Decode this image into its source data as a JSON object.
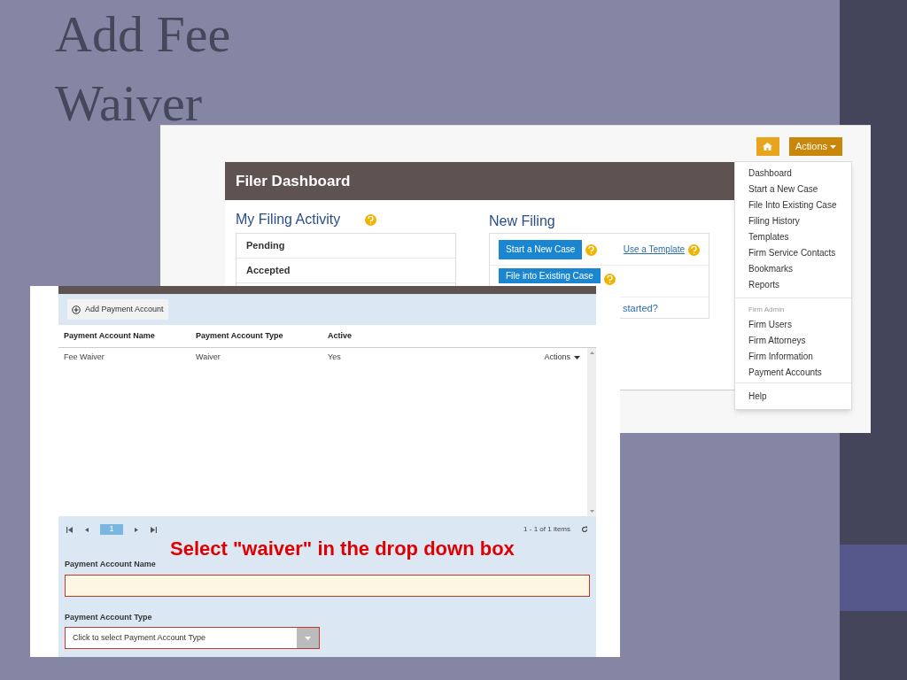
{
  "slide": {
    "title": "Add Fee Waiver",
    "callout": "Select \"waiver\" in the drop down box"
  },
  "dashboard": {
    "actions_button": "Actions",
    "header": "Filer Dashboard",
    "activity": {
      "title": "My Filing Activity",
      "items": [
        "Pending",
        "Accepted"
      ]
    },
    "new_filing": {
      "title": "New Filing",
      "start_button": "Start a New Case",
      "template_link": "Use a Template",
      "file_button": "File into Existing Case",
      "help_link": "started?"
    },
    "menu": {
      "groups": [
        {
          "items": [
            "Dashboard",
            "Start a New Case",
            "File Into Existing Case",
            "Filing History",
            "Templates",
            "Firm Service Contacts",
            "Bookmarks",
            "Reports"
          ]
        },
        {
          "heading": "Firm Admin",
          "items": [
            "Firm Users",
            "Firm Attorneys",
            "Firm Information",
            "Payment Accounts"
          ]
        },
        {
          "items": [
            "Help"
          ]
        }
      ]
    }
  },
  "payment": {
    "add_button": "Add Payment Account",
    "columns": [
      "Payment Account Name",
      "Payment Account Type",
      "Active"
    ],
    "rows": [
      {
        "cells": [
          "Fee Waiver",
          "Waiver",
          "Yes"
        ],
        "action": "Actions"
      }
    ],
    "pager": {
      "page": "1",
      "summary": "1 - 1 of 1 items"
    },
    "form": {
      "name_label": "Payment Account Name",
      "name_invalid": true,
      "type_label": "Payment Account Type",
      "type_placeholder": "Click to select Payment Account Type",
      "type_invalid": true
    }
  }
}
